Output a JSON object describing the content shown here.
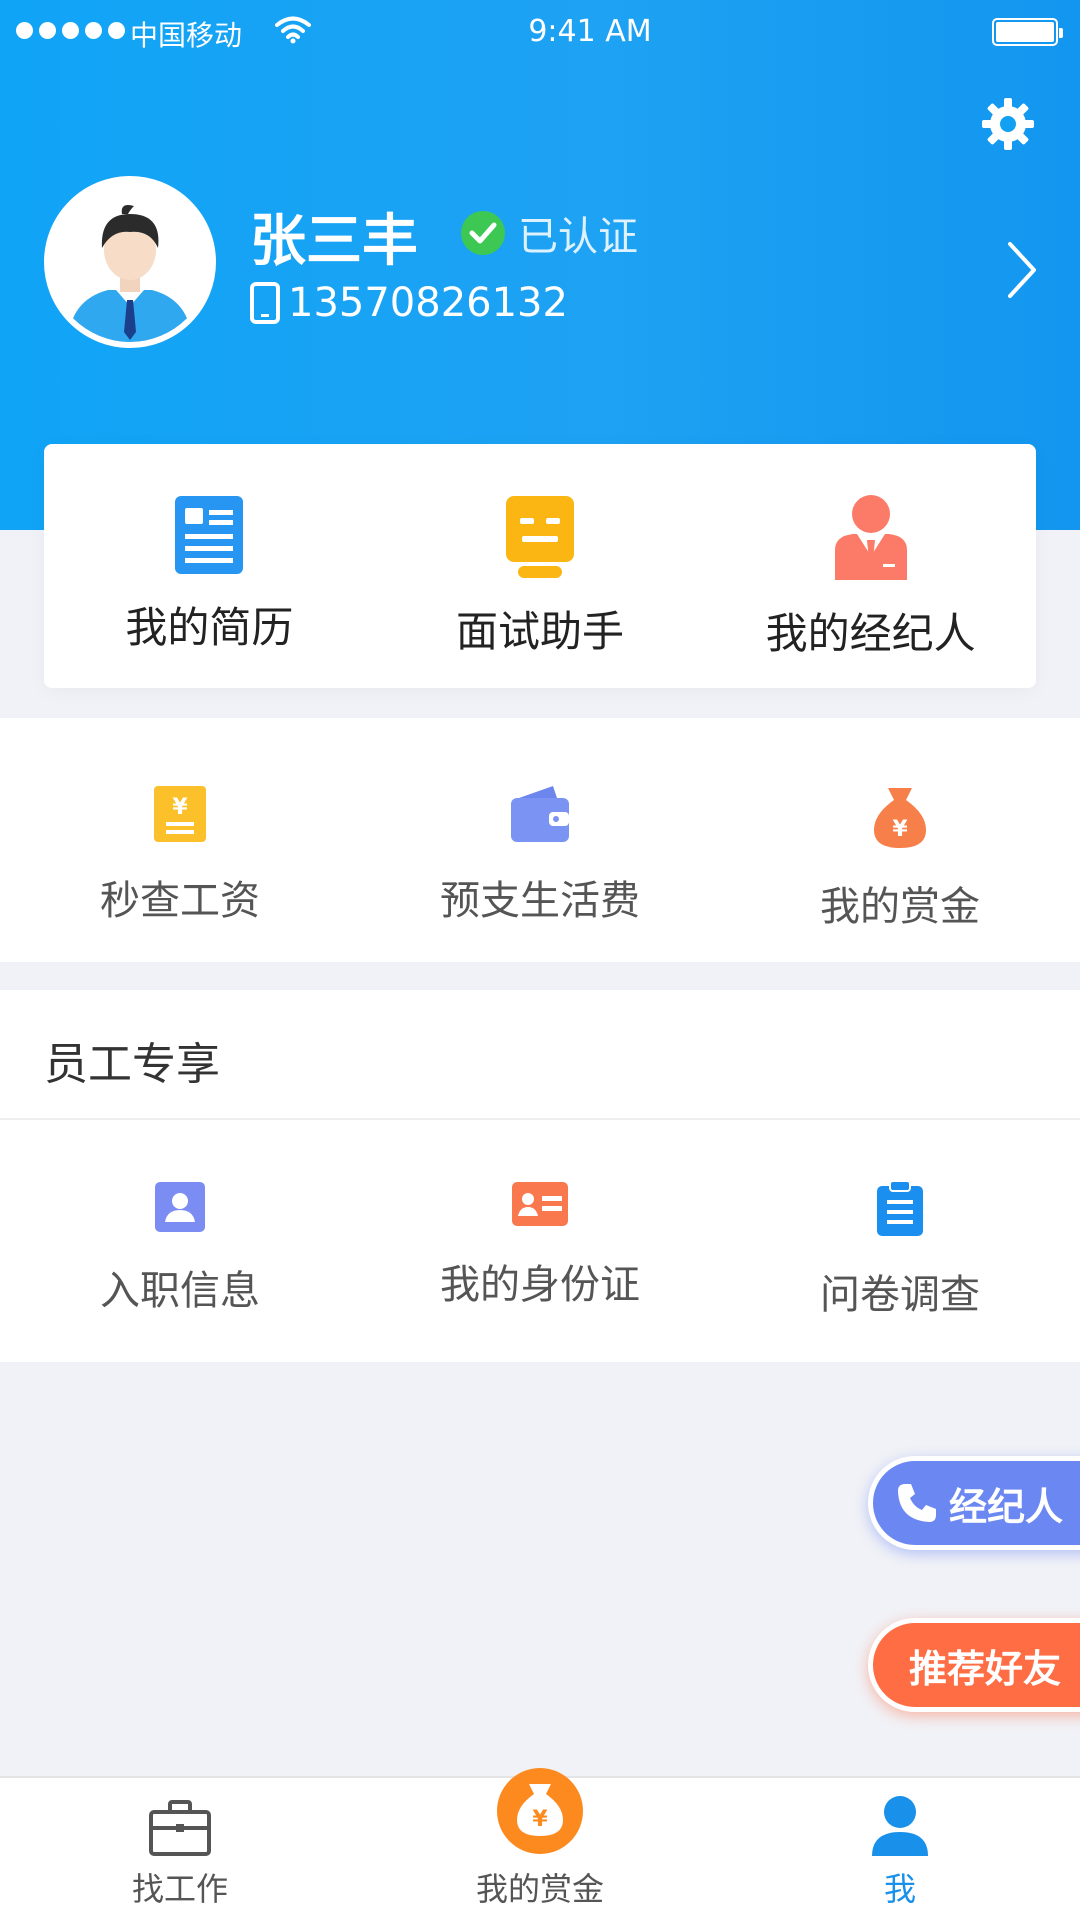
{
  "status_bar": {
    "carrier": "中国移动",
    "time": "9:41 AM"
  },
  "profile": {
    "name": "张三丰",
    "verified_label": "已认证",
    "phone": "13570826132"
  },
  "card_items": [
    {
      "label": "我的简历",
      "icon": "resume-icon"
    },
    {
      "label": "面试助手",
      "icon": "robot-icon"
    },
    {
      "label": "我的经纪人",
      "icon": "agent-person-icon"
    }
  ],
  "finance_items": [
    {
      "label": "秒查工资",
      "icon": "salary-doc-icon"
    },
    {
      "label": "预支生活费",
      "icon": "wallet-icon"
    },
    {
      "label": "我的赏金",
      "icon": "money-bag-icon"
    }
  ],
  "employee_section": {
    "title": "员工专享",
    "items": [
      {
        "label": "入职信息",
        "icon": "person-card-icon"
      },
      {
        "label": "我的身份证",
        "icon": "id-card-icon"
      },
      {
        "label": "问卷调查",
        "icon": "clipboard-icon"
      }
    ]
  },
  "floating": {
    "agent_label": "经纪人",
    "refer_label": "推荐好友"
  },
  "tabbar": {
    "items": [
      {
        "label": "找工作",
        "icon": "briefcase-icon",
        "active": false
      },
      {
        "label": "我的赏金",
        "icon": "money-bag-icon",
        "active": false
      },
      {
        "label": "我",
        "icon": "user-icon",
        "active": true
      }
    ]
  },
  "colors": {
    "header_blue": "#10a4f6",
    "active_tab": "#1990ea",
    "agent_fab": "#6b87f2",
    "refer_fab": "#ff6d45"
  }
}
